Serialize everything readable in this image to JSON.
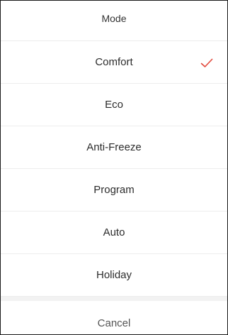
{
  "sheet": {
    "title": "Mode",
    "selected_index": 0,
    "accent_color": "#e2473a",
    "options": [
      {
        "label": "Comfort",
        "name": "option-comfort",
        "selected": true
      },
      {
        "label": "Eco",
        "name": "option-eco",
        "selected": false
      },
      {
        "label": "Anti-Freeze",
        "name": "option-anti-freeze",
        "selected": false
      },
      {
        "label": "Program",
        "name": "option-program",
        "selected": false
      },
      {
        "label": "Auto",
        "name": "option-auto",
        "selected": false
      },
      {
        "label": "Holiday",
        "name": "option-holiday",
        "selected": false
      }
    ],
    "cancel_label": "Cancel",
    "check_icon": "checkmark-icon"
  }
}
